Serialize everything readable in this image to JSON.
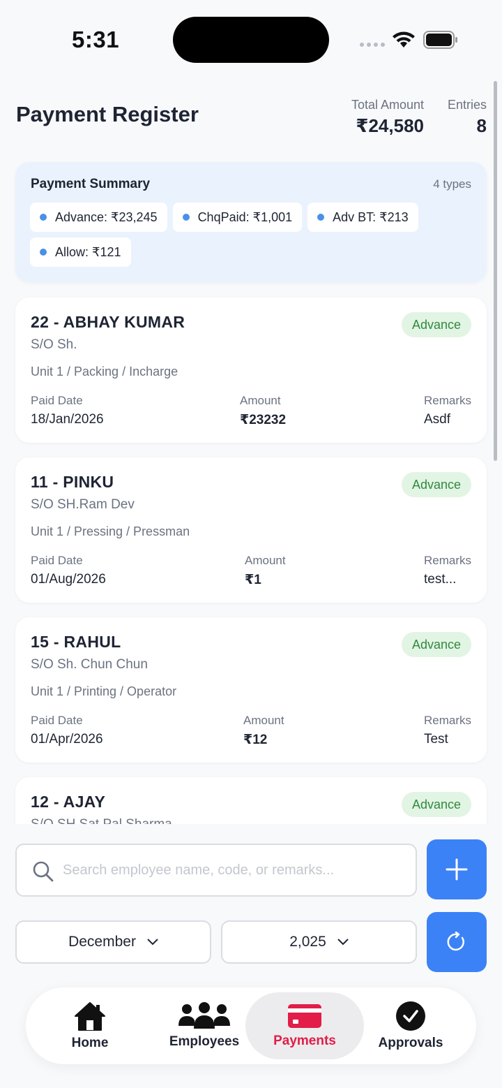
{
  "status_bar": {
    "time": "5:31"
  },
  "header": {
    "title": "Payment Register",
    "total_amount_label": "Total Amount",
    "total_amount": "₹24,580",
    "entries_label": "Entries",
    "entries": "8"
  },
  "summary": {
    "title": "Payment Summary",
    "count": "4 types",
    "chips": [
      {
        "label": "Advance: ₹23,245"
      },
      {
        "label": "ChqPaid: ₹1,001"
      },
      {
        "label": "Adv BT: ₹213"
      },
      {
        "label": "Allow: ₹121"
      }
    ],
    "chip_color": "#4a90e8"
  },
  "labels": {
    "paid_date": "Paid Date",
    "amount": "Amount",
    "remarks": "Remarks"
  },
  "entries": [
    {
      "name": "22 - ABHAY KUMAR",
      "badge": "Advance",
      "father": "S/O Sh.",
      "dept": "Unit 1 / Packing / Incharge",
      "paid_date": "18/Jan/2026",
      "amount": "₹23232",
      "remarks": "Asdf"
    },
    {
      "name": "11 - PINKU",
      "badge": "Advance",
      "father": "S/O SH.Ram Dev",
      "dept": "Unit 1 / Pressing / Pressman",
      "paid_date": "01/Aug/2026",
      "amount": "₹1",
      "remarks": "test..."
    },
    {
      "name": "15 - RAHUL",
      "badge": "Advance",
      "father": "S/O Sh. Chun Chun",
      "dept": "Unit 1 / Printing / Operator",
      "paid_date": "01/Apr/2026",
      "amount": "₹12",
      "remarks": "Test"
    },
    {
      "name": "12 - AJAY",
      "badge": "Advance",
      "father": "S/O SH.Sat Pal Sharma",
      "dept": "",
      "paid_date": "",
      "amount": "",
      "remarks": ""
    }
  ],
  "search": {
    "placeholder": "Search employee name, code, or remarks..."
  },
  "filters": {
    "month": "December",
    "year": "2,025"
  },
  "tabs": [
    {
      "label": "Home",
      "icon": "home-icon"
    },
    {
      "label": "Employees",
      "icon": "users-icon"
    },
    {
      "label": "Payments",
      "icon": "credit-card-icon",
      "active": true
    },
    {
      "label": "Approvals",
      "icon": "check-circle-icon"
    }
  ],
  "colors": {
    "accent": "#3b82f6",
    "active_tab": "#e11d48",
    "badge_bg": "#e2f4e4",
    "badge_text": "#2f8a3d"
  }
}
